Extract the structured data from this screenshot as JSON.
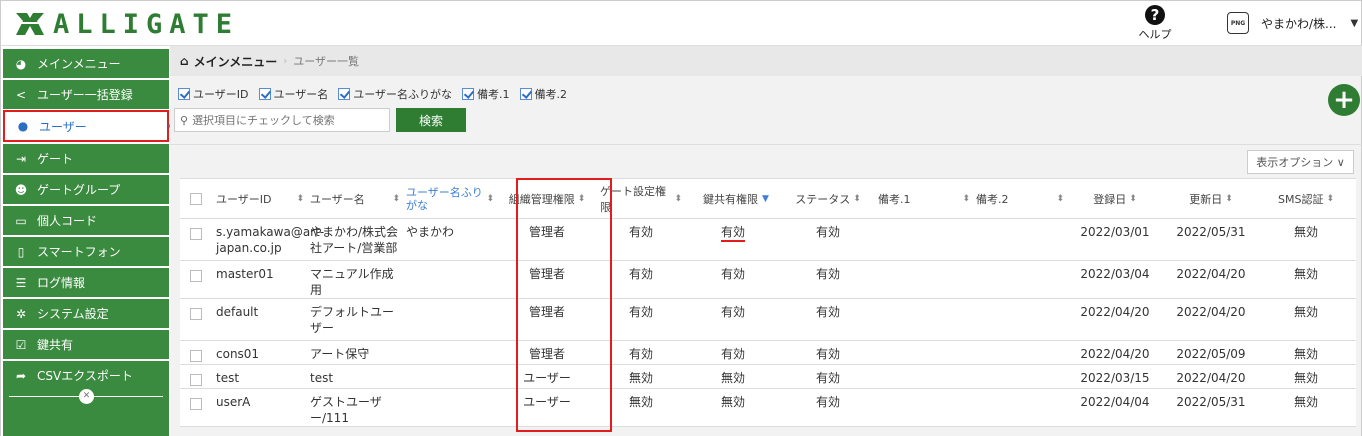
{
  "header": {
    "logo_text": "ALLIGATE",
    "help_label": "ヘルプ",
    "png_label": "PNG",
    "user_name": "やまかわ/株..."
  },
  "sidebar": {
    "items": [
      {
        "label": "メインメニュー",
        "icon": "dashboard-icon"
      },
      {
        "label": "ユーザー一括登録",
        "icon": "share-icon"
      },
      {
        "label": "ユーザー",
        "icon": "user-icon",
        "active": true
      },
      {
        "label": "ゲート",
        "icon": "sign-in-icon"
      },
      {
        "label": "ゲートグループ",
        "icon": "users-icon"
      },
      {
        "label": "個人コード",
        "icon": "credit-card-icon"
      },
      {
        "label": "スマートフォン",
        "icon": "mobile-icon"
      },
      {
        "label": "ログ情報",
        "icon": "list-icon"
      },
      {
        "label": "システム設定",
        "icon": "gear-icon"
      },
      {
        "label": "鍵共有",
        "icon": "check-square-icon"
      },
      {
        "label": "CSVエクスポート",
        "icon": "share-arrow-icon"
      }
    ]
  },
  "breadcrumb": {
    "home": "メインメニュー",
    "current": "ユーザー一覧"
  },
  "filters": [
    {
      "label": "ユーザーID",
      "checked": true
    },
    {
      "label": "ユーザー名",
      "checked": true
    },
    {
      "label": "ユーザー名ふりがな",
      "checked": true
    },
    {
      "label": "備考.1",
      "checked": true
    },
    {
      "label": "備考.2",
      "checked": true
    }
  ],
  "search": {
    "placeholder": "選択項目にチェックして検索",
    "button_label": "検索"
  },
  "display_options_label": "表示オプション ∨",
  "table": {
    "columns": [
      {
        "label": "ユーザーID"
      },
      {
        "label": "ユーザー名"
      },
      {
        "label": "ユーザー名ふりがな"
      },
      {
        "label": "組織管理権限"
      },
      {
        "label": "ゲート設定権限"
      },
      {
        "label": "鍵共有権限"
      },
      {
        "label": "ステータス"
      },
      {
        "label": "備考.1"
      },
      {
        "label": "備考.2"
      },
      {
        "label": "登録日"
      },
      {
        "label": "更新日"
      },
      {
        "label": "SMS認証"
      }
    ],
    "rows": [
      {
        "id": "s.yamakawa@art-japan.co.jp",
        "name": "やまかわ/株式会社アート/営業部",
        "kana": "やまかわ",
        "org": "管理者",
        "gate": "有効",
        "key": "有効",
        "status": "有効",
        "note1": "",
        "note2": "",
        "created": "2022/03/01",
        "updated": "2022/05/31",
        "sms": "無効"
      },
      {
        "id": "master01",
        "name": "マニュアル作成用",
        "kana": "",
        "org": "管理者",
        "gate": "有効",
        "key": "有効",
        "status": "有効",
        "note1": "",
        "note2": "",
        "created": "2022/03/04",
        "updated": "2022/04/20",
        "sms": "無効"
      },
      {
        "id": "default",
        "name": "デフォルトユーザー",
        "kana": "",
        "org": "管理者",
        "gate": "有効",
        "key": "有効",
        "status": "有効",
        "note1": "",
        "note2": "",
        "created": "2022/04/20",
        "updated": "2022/04/20",
        "sms": "無効"
      },
      {
        "id": "cons01",
        "name": "アート保守",
        "kana": "",
        "org": "管理者",
        "gate": "有効",
        "key": "有効",
        "status": "有効",
        "note1": "",
        "note2": "",
        "created": "2022/04/20",
        "updated": "2022/05/09",
        "sms": "無効"
      },
      {
        "id": "test",
        "name": "test",
        "kana": "",
        "org": "ユーザー",
        "gate": "無効",
        "key": "無効",
        "status": "有効",
        "note1": "",
        "note2": "",
        "created": "2022/03/15",
        "updated": "2022/04/20",
        "sms": "無効"
      },
      {
        "id": "userA",
        "name": "ゲストユーザー/111",
        "kana": "",
        "org": "ユーザー",
        "gate": "無効",
        "key": "無効",
        "status": "有効",
        "note1": "",
        "note2": "",
        "created": "2022/04/04",
        "updated": "2022/05/31",
        "sms": "無効"
      }
    ]
  },
  "colors": {
    "brand_green": "#2e7d32",
    "sidebar_green": "#3a8a3f",
    "highlight_red": "#e11d1d",
    "active_blue": "#2b6fc4"
  }
}
